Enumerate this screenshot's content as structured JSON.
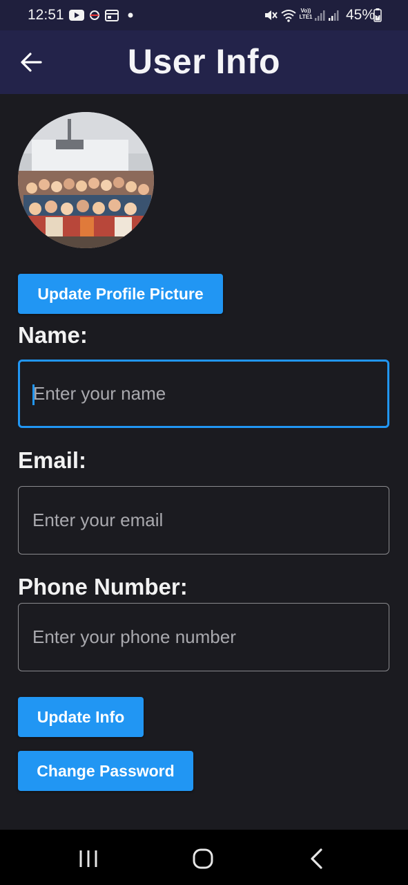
{
  "status_bar": {
    "time": "12:51",
    "battery": "45%",
    "icons": [
      "youtube-icon",
      "notification-icon",
      "calendar-icon",
      "dot-icon",
      "mute-icon",
      "wifi-icon",
      "volte-icon",
      "signal-icon",
      "signal-icon",
      "battery-icon"
    ],
    "volte_text": "Vo))",
    "lte_text": "LTE1"
  },
  "app_bar": {
    "title": "User Info",
    "back_icon": "arrow-left-icon"
  },
  "profile": {
    "avatar_icon": "group-photo-avatar",
    "update_picture_label": "Update Profile Picture"
  },
  "form": {
    "name": {
      "label": "Name:",
      "placeholder": "Enter your name",
      "value": ""
    },
    "email": {
      "label": "Email:",
      "placeholder": "Enter your email",
      "value": ""
    },
    "phone": {
      "label": "Phone Number:",
      "placeholder": "Enter your phone number",
      "value": ""
    }
  },
  "actions": {
    "update_info_label": "Update Info",
    "change_password_label": "Change Password"
  },
  "nav_bar": {
    "icons": [
      "recent-apps-icon",
      "home-icon",
      "back-nav-icon"
    ]
  },
  "colors": {
    "accent": "#2196f3",
    "app_bar": "#23234a",
    "status_bar": "#1f1f3d",
    "background": "#1b1b20"
  }
}
